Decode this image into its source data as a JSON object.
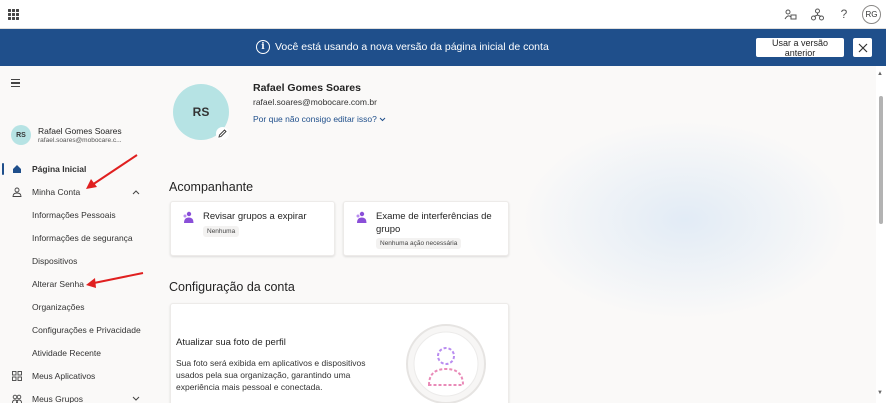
{
  "topbar": {
    "avatar_initials": "RG",
    "icons": [
      "app-launcher-icon",
      "organization-icon",
      "network-icon",
      "help-icon"
    ]
  },
  "banner": {
    "message": "Você está usando a nova versão da página inicial de conta",
    "button_label": "Usar a versão anterior",
    "background": "#1f4f8b"
  },
  "sidebar": {
    "user": {
      "initials": "RS",
      "name": "Rafael Gomes Soares",
      "email": "rafael.soares@mobocare.c..."
    },
    "items": [
      {
        "label": "Página Inicial",
        "icon": "home-icon",
        "active": true
      },
      {
        "label": "Minha Conta",
        "icon": "person-icon",
        "expanded": true
      },
      {
        "label": "Informações Pessoais"
      },
      {
        "label": "Informações de segurança"
      },
      {
        "label": "Dispositivos"
      },
      {
        "label": "Alterar Senha"
      },
      {
        "label": "Organizações"
      },
      {
        "label": "Configurações e Privacidade"
      },
      {
        "label": "Atividade Recente"
      },
      {
        "label": "Meus Aplicativos",
        "icon": "apps-icon"
      },
      {
        "label": "Meus Grupos",
        "icon": "groups-icon"
      }
    ]
  },
  "profile": {
    "initials": "RS",
    "name": "Rafael Gomes Soares",
    "email": "rafael.soares@mobocare.com.br",
    "edit_link": "Por que não consigo editar isso?"
  },
  "companion": {
    "title": "Acompanhante",
    "cards": [
      {
        "title": "Revisar grupos a expirar",
        "badge": "Nenhuma"
      },
      {
        "title": "Exame de interferências de grupo",
        "badge": "Nenhuma ação necessária"
      }
    ]
  },
  "account_settings": {
    "title": "Configuração da conta",
    "photo_card": {
      "title": "Atualizar sua foto de perfil",
      "description": "Sua foto será exibida em aplicativos e dispositivos usados pela sua organização, garantindo uma experiência mais pessoal e conectada."
    }
  },
  "colors": {
    "accent": "#1f4f8b",
    "avatar_bg": "#b6e3e4",
    "annotation": "#e02020",
    "card_icon": "#8a4fd8"
  }
}
